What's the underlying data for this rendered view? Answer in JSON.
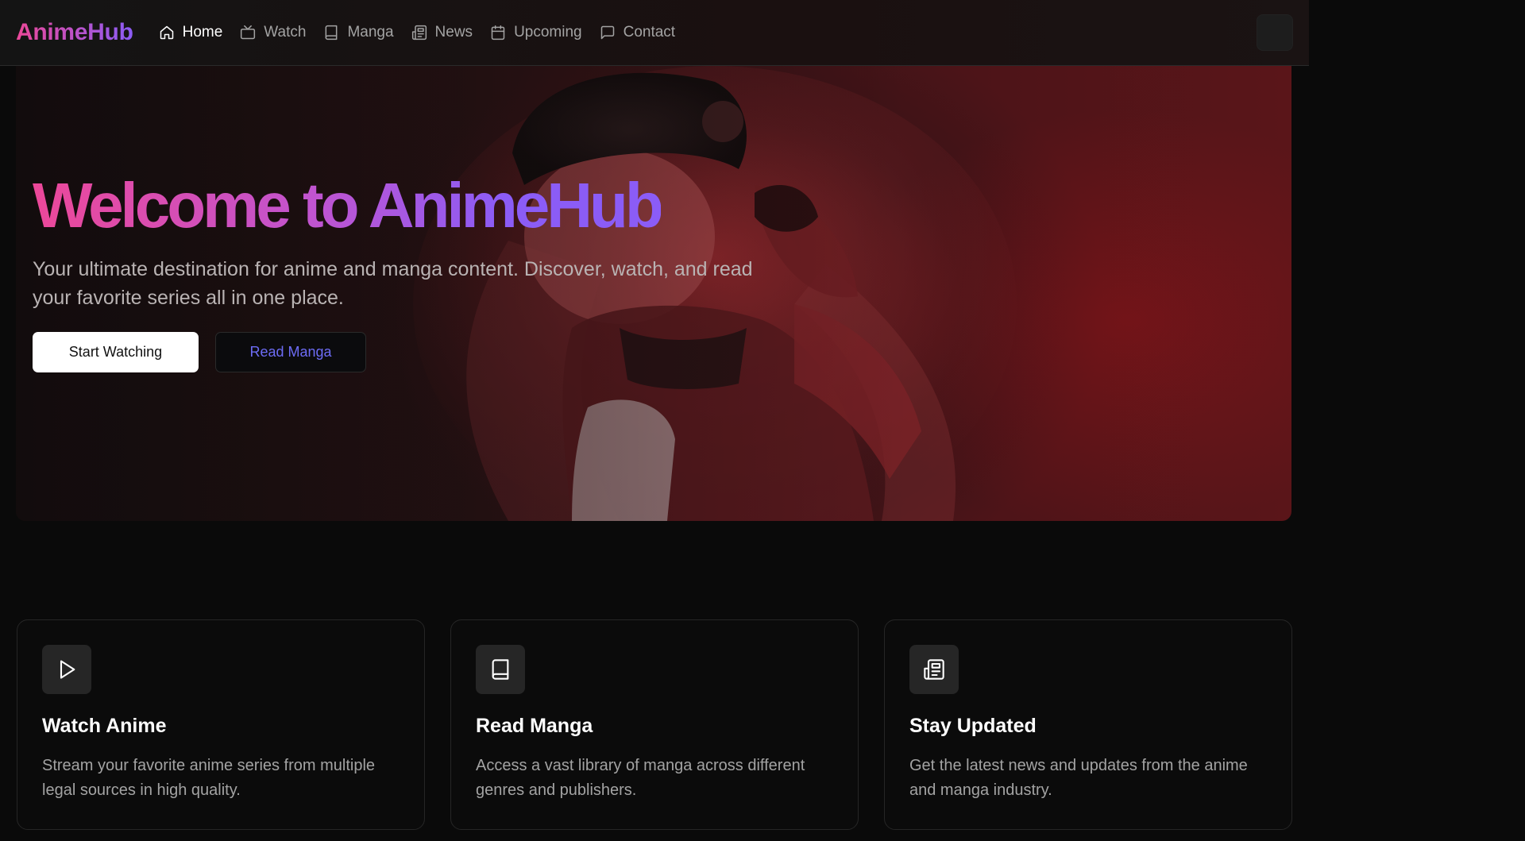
{
  "brand": {
    "logo": "AnimeHub",
    "gradient_start": "#ec4899",
    "gradient_end": "#8b5cf6"
  },
  "nav": {
    "items": [
      {
        "label": "Home",
        "icon": "home-icon",
        "active": true
      },
      {
        "label": "Watch",
        "icon": "tv-icon",
        "active": false
      },
      {
        "label": "Manga",
        "icon": "book-icon",
        "active": false
      },
      {
        "label": "News",
        "icon": "newspaper-icon",
        "active": false
      },
      {
        "label": "Upcoming",
        "icon": "calendar-icon",
        "active": false
      },
      {
        "label": "Contact",
        "icon": "message-icon",
        "active": false
      }
    ]
  },
  "hero": {
    "title": "Welcome to AnimeHub",
    "subtitle": "Your ultimate destination for anime and manga content. Discover, watch, and read your favorite series all in one place.",
    "primary_button": "Start Watching",
    "secondary_button": "Read Manga",
    "background_color": "#5a1519"
  },
  "features": [
    {
      "icon": "play-icon",
      "title": "Watch Anime",
      "description": "Stream your favorite anime series from multiple legal sources in high quality."
    },
    {
      "icon": "book-icon",
      "title": "Read Manga",
      "description": "Access a vast library of manga across different genres and publishers."
    },
    {
      "icon": "newspaper-icon",
      "title": "Stay Updated",
      "description": "Get the latest news and updates from the anime and manga industry."
    }
  ],
  "colors": {
    "background": "#0a0a0a",
    "card_border": "#262626",
    "muted_text": "#a3a3a3",
    "link_accent": "#6d6cf5"
  }
}
